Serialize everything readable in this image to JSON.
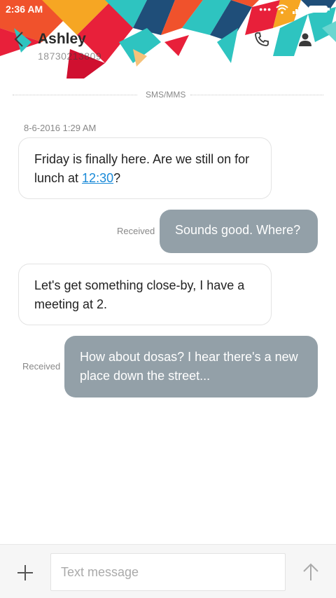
{
  "status_bar": {
    "time": "2:36 AM"
  },
  "header": {
    "contact_name": "Ashley",
    "contact_number": "18730213809"
  },
  "icons": {
    "back": "back-arrow-icon",
    "call": "phone-icon",
    "profile": "person-icon",
    "attach": "plus-icon",
    "send": "send-arrow-icon"
  },
  "thread": {
    "separator_label": "SMS/MMS",
    "timestamp": "8-6-2016 1:29 AM",
    "messages": [
      {
        "direction": "in",
        "text_before": "Friday is finally here. Are we still on for lunch at ",
        "link": "12:30",
        "text_after": "?"
      },
      {
        "direction": "out",
        "status": "Received",
        "text": "Sounds good. Where?"
      },
      {
        "direction": "in",
        "text": "Let's get something close-by, I have a meeting at 2."
      },
      {
        "direction": "out",
        "status": "Received",
        "text": "How about dosas? I hear there's a new place down the street..."
      }
    ]
  },
  "composer": {
    "placeholder": "Text message",
    "value": ""
  },
  "colors": {
    "accent_link": "#1a8ad8",
    "outgoing_bubble": "#93a0a8",
    "header_art": [
      "#f0522c",
      "#2ec4c0",
      "#e8203a",
      "#f6a623",
      "#1f4e79"
    ]
  }
}
